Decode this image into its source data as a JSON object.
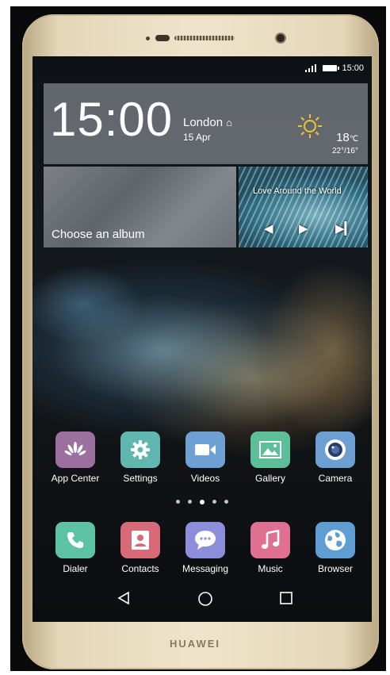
{
  "device": {
    "brand": "HUAWEI"
  },
  "status_bar": {
    "time": "15:00"
  },
  "clock_widget": {
    "time": "15:00",
    "city": "London",
    "date": "15 Apr",
    "temp": "18",
    "temp_unit": "℃",
    "range": "22°/16°"
  },
  "album_widget": {
    "label": "Choose an album"
  },
  "music_widget": {
    "title": "Love Around the World"
  },
  "apps_row1": [
    {
      "label": "App Center",
      "color": "#9b6f9e"
    },
    {
      "label": "Settings",
      "color": "#5fb7b0"
    },
    {
      "label": "Videos",
      "color": "#6fa0d4"
    },
    {
      "label": "Gallery",
      "color": "#5cbf9a"
    },
    {
      "label": "Camera",
      "color": "#6e9fd3"
    }
  ],
  "apps_row2": [
    {
      "label": "Dialer",
      "color": "#5ec3a5"
    },
    {
      "label": "Contacts",
      "color": "#d86a78"
    },
    {
      "label": "Messaging",
      "color": "#8d8ed9"
    },
    {
      "label": "Music",
      "color": "#e07092"
    },
    {
      "label": "Browser",
      "color": "#5f9ed3"
    }
  ],
  "pager": {
    "pages": 5,
    "current": 3
  }
}
